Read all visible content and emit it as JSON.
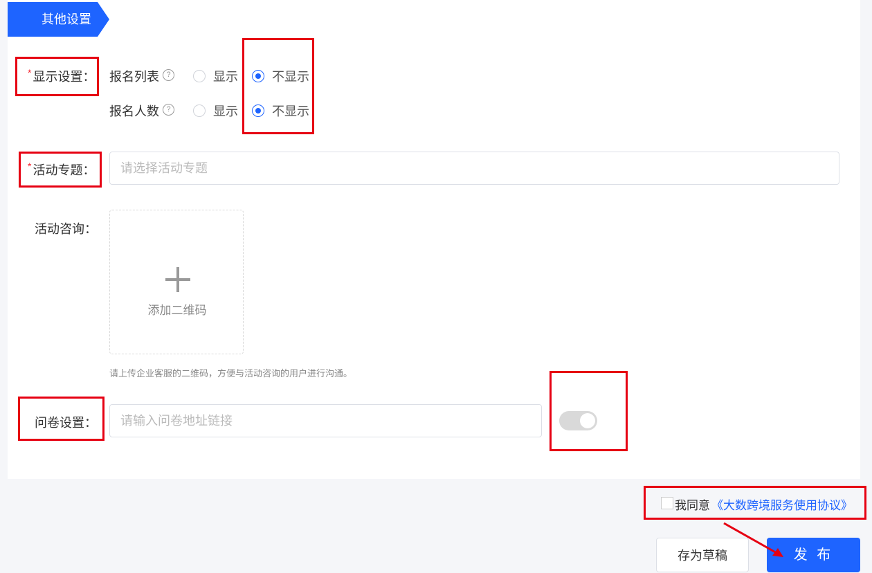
{
  "section": {
    "title": "其他设置"
  },
  "display_settings": {
    "required_mark": "*",
    "label": "显示设置：",
    "rows": [
      {
        "label": "报名列表",
        "help": "?",
        "option_show": "显示",
        "option_hide": "不显示",
        "selected": "不显示"
      },
      {
        "label": "报名人数",
        "help": "?",
        "option_show": "显示",
        "option_hide": "不显示",
        "selected": "不显示"
      }
    ]
  },
  "topic": {
    "required_mark": "*",
    "label": "活动专题：",
    "placeholder": "请选择活动专题"
  },
  "consult": {
    "label": "活动咨询：",
    "upload_label": "添加二维码",
    "hint": "请上传企业客服的二维码，方便与活动咨询的用户进行沟通。"
  },
  "survey": {
    "label": "问卷设置：",
    "placeholder": "请输入问卷地址链接",
    "switch_on": false
  },
  "agreement": {
    "prefix": "我同意",
    "link": "《大数跨境服务使用协议》",
    "checked": false
  },
  "actions": {
    "draft": "存为草稿",
    "publish": "发 布"
  },
  "colors": {
    "primary": "#1e64ff",
    "annotation": "#e60012",
    "required": "#f5222d"
  }
}
